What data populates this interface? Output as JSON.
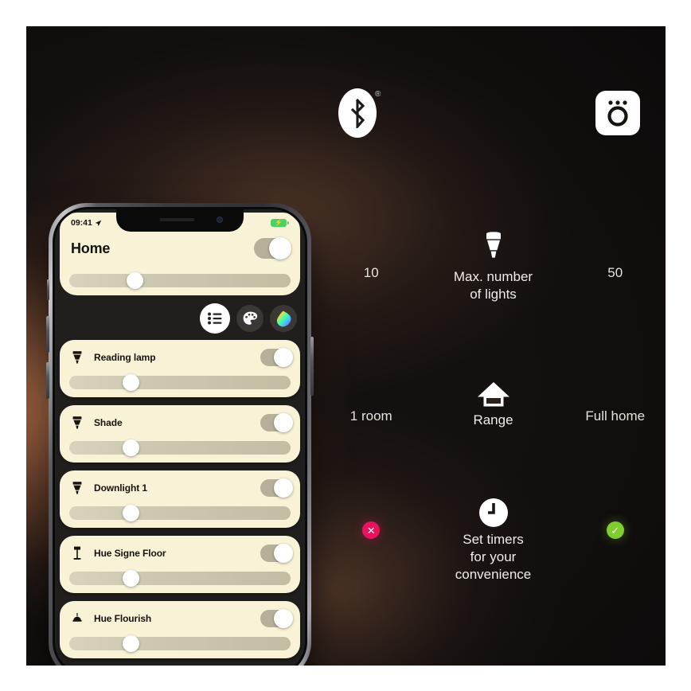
{
  "phone": {
    "status_bar": {
      "time": "09:41",
      "location_icon": "location-arrow-icon",
      "battery_icon": "battery-charging-icon"
    },
    "header": {
      "title": "Home",
      "toggle_state": "on",
      "brightness_percent": 32
    },
    "segmented_buttons": [
      {
        "name": "list-view-button",
        "icon": "list-icon",
        "active": true
      },
      {
        "name": "scenes-button",
        "icon": "palette-icon",
        "active": false
      },
      {
        "name": "color-picker-button",
        "icon": "color-drop-icon",
        "active": false
      }
    ],
    "lights": [
      {
        "name": "Reading lamp",
        "icon": "bulb-spot-icon",
        "toggle_state": "on",
        "brightness_percent": 30
      },
      {
        "name": "Shade",
        "icon": "bulb-spot-icon",
        "toggle_state": "on",
        "brightness_percent": 30
      },
      {
        "name": "Downlight 1",
        "icon": "bulb-spot-icon",
        "toggle_state": "on",
        "brightness_percent": 30
      },
      {
        "name": "Hue Signe Floor",
        "icon": "floor-lamp-icon",
        "toggle_state": "on",
        "brightness_percent": 30
      },
      {
        "name": "Hue Flourish",
        "icon": "ceiling-lamp-icon",
        "toggle_state": "on",
        "brightness_percent": 30
      }
    ]
  },
  "panel": {
    "logos": {
      "left": {
        "icon": "bluetooth-icon",
        "trademark": "®"
      },
      "right": {
        "icon": "hue-bridge-icon"
      }
    },
    "features": [
      {
        "icon": "bulb-icon",
        "label": "Max. number\nof lights",
        "label_line1": "Max. number",
        "label_line2": "of lights",
        "left_value": "10",
        "right_value": "50"
      },
      {
        "icon": "house-icon",
        "label": "Range",
        "left_value": "1 room",
        "right_value": "Full home"
      },
      {
        "icon": "clock-icon",
        "label_line1": "Set timers",
        "label_line2": "for your",
        "label_line3": "convenience",
        "left_value": "✕",
        "right_value": "✓",
        "left_badge": "cross-badge",
        "right_badge": "check-badge"
      }
    ]
  },
  "colors": {
    "card_cream": "#f8f2d6",
    "accent_pink": "#e8135c",
    "accent_green": "#7fcd2e",
    "battery_green": "#4cd264",
    "background_dark": "#14100f",
    "glow_copper": "#c47a4e"
  }
}
